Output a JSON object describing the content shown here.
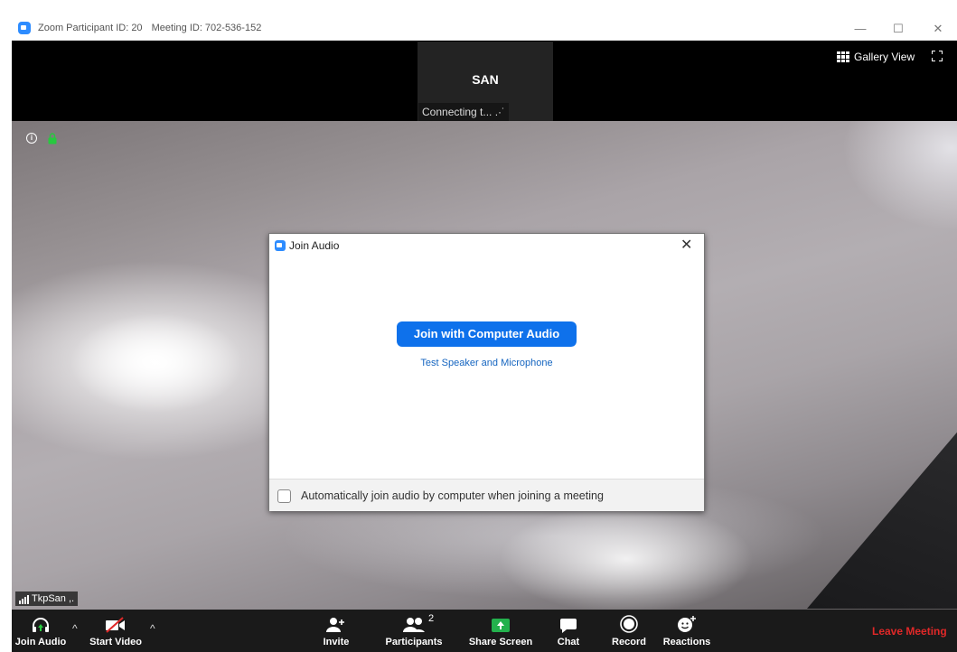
{
  "window": {
    "app_title": "Zoom Participant ID: 20",
    "meeting_id": "Meeting ID: 702-536-152",
    "minimize_label": "—",
    "maximize_label": "☐",
    "close_label": "✕"
  },
  "topbar": {
    "thumbnail_name": "SAN",
    "thumbnail_status": "Connecting t... .·˙",
    "gallery_view_label": "Gallery View"
  },
  "video": {
    "participant_label": "TkpSan ,."
  },
  "dialog": {
    "title": "Join Audio",
    "close_label": "✕",
    "join_button": "Join with Computer Audio",
    "test_link": "Test Speaker and Microphone",
    "auto_join_label": "Automatically join audio by computer when joining a meeting",
    "auto_join_checked": false
  },
  "toolbar": {
    "join_audio": "Join Audio",
    "start_video": "Start Video",
    "invite": "Invite",
    "participants": "Participants",
    "participants_count": "2",
    "share_screen": "Share Screen",
    "chat": "Chat",
    "record": "Record",
    "reactions": "Reactions",
    "leave_meeting": "Leave Meeting",
    "caret": "^"
  },
  "colors": {
    "accent": "#0e71eb",
    "share_green": "#23b14d",
    "leave_red": "#e02828",
    "lock_green": "#27c93f"
  }
}
